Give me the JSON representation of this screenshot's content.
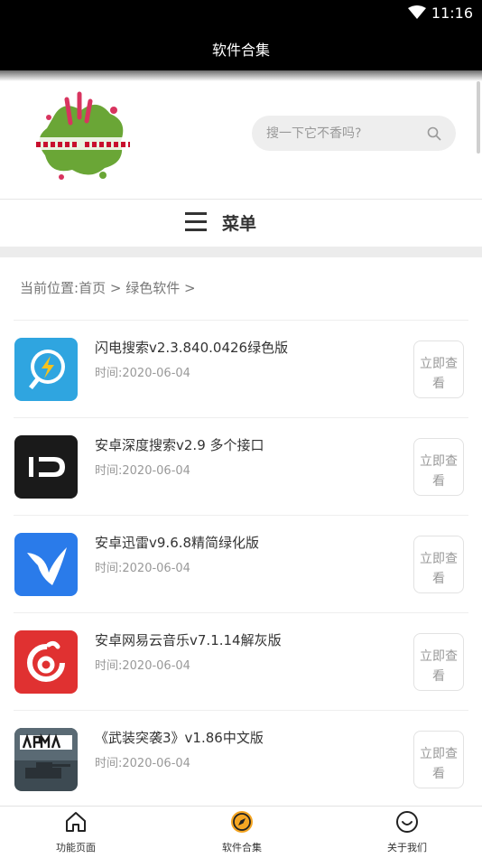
{
  "status_bar": {
    "time": "11:16",
    "wifi_icon": "wifi-icon"
  },
  "title_bar": {
    "title": "软件合集"
  },
  "search": {
    "placeholder": "搜一下它不香吗?",
    "value": ""
  },
  "menu": {
    "label": "菜单"
  },
  "breadcrumb": {
    "prefix": "当前位置:",
    "home": "首页",
    "separator1": ">",
    "category": "绿色软件",
    "separator2": ">"
  },
  "list": {
    "button_label": "立即查看",
    "items": [
      {
        "title": "闪电搜索v2.3.840.0426绿色版",
        "date": "时间:2020-06-04",
        "icon": "lightning-search-icon"
      },
      {
        "title": "安卓深度搜索v2.9 多个接口",
        "date": "时间:2020-06-04",
        "icon": "deep-search-icon"
      },
      {
        "title": "安卓迅雷v9.6.8精简绿化版",
        "date": "时间:2020-06-04",
        "icon": "thunder-bird-icon"
      },
      {
        "title": "安卓网易云音乐v7.1.14解灰版",
        "date": "时间:2020-06-04",
        "icon": "netease-music-icon"
      },
      {
        "title": "《武装突袭3》v1.86中文版",
        "date": "时间:2020-06-04",
        "icon": "arma-game-icon"
      }
    ]
  },
  "tab_bar": {
    "tabs": [
      {
        "label": "功能页面",
        "icon": "home-icon"
      },
      {
        "label": "软件合集",
        "icon": "compass-icon",
        "active": true
      },
      {
        "label": "关于我们",
        "icon": "smile-icon"
      }
    ]
  },
  "colors": {
    "active_tab": "#f5a623",
    "header_bg": "#000000",
    "page_bg": "#ffffff"
  }
}
